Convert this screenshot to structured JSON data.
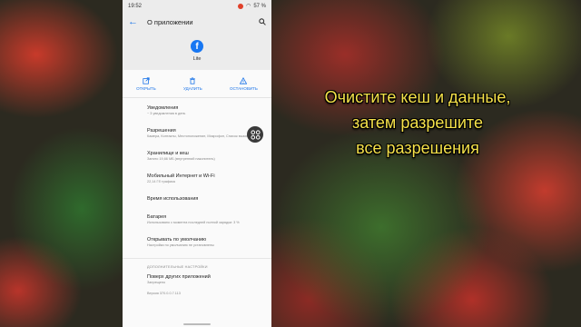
{
  "status_bar": {
    "time": "19:52",
    "battery": "57 %"
  },
  "app_bar": {
    "title": "О приложении"
  },
  "app": {
    "logo_letter": "f",
    "name": "Lite"
  },
  "actions": [
    {
      "label": "ОТКРЫТЬ",
      "icon": "open-external-icon"
    },
    {
      "label": "УДАЛИТЬ",
      "icon": "trash-icon"
    },
    {
      "label": "ОСТАНОВИТЬ",
      "icon": "warning-icon"
    }
  ],
  "settings": {
    "notifications": {
      "title": "Уведомления",
      "subtitle": "~ 3 уведомления в день"
    },
    "permissions": {
      "title": "Разрешения",
      "subtitle": "Камера, Контакты, Местоположение, Микрофон, Список вызовов"
    },
    "storage": {
      "title": "Хранилище и кеш",
      "subtitle": "Занято 19,66 МБ (внутренний накопитель)"
    },
    "mobile_data": {
      "title": "Мобильный Интернет и Wi-Fi",
      "subtitle": "22,14 Гб трафика"
    },
    "screen_time": {
      "title": "Время использования"
    },
    "battery": {
      "title": "Батарея",
      "subtitle": "Использовано с момента последней полной зарядки: 3 %"
    },
    "open_default": {
      "title": "Открывать по умолчанию",
      "subtitle": "Настройки по умолчанию не установлены"
    }
  },
  "advanced": {
    "header": "ДОПОЛНИТЕЛЬНЫЕ НАСТРОЙКИ",
    "overlay": {
      "title": "Поверх других приложений",
      "subtitle": "Запрещено"
    },
    "version": "Версия 370.0.0.7.113"
  },
  "caption": {
    "line1": "Очистите кеш и данные,",
    "line2": "затем разрешите",
    "line3": "все разрешения"
  },
  "colors": {
    "accent": "#1a73e8",
    "caption": "#f5e14a",
    "facebook": "#1877f2"
  }
}
